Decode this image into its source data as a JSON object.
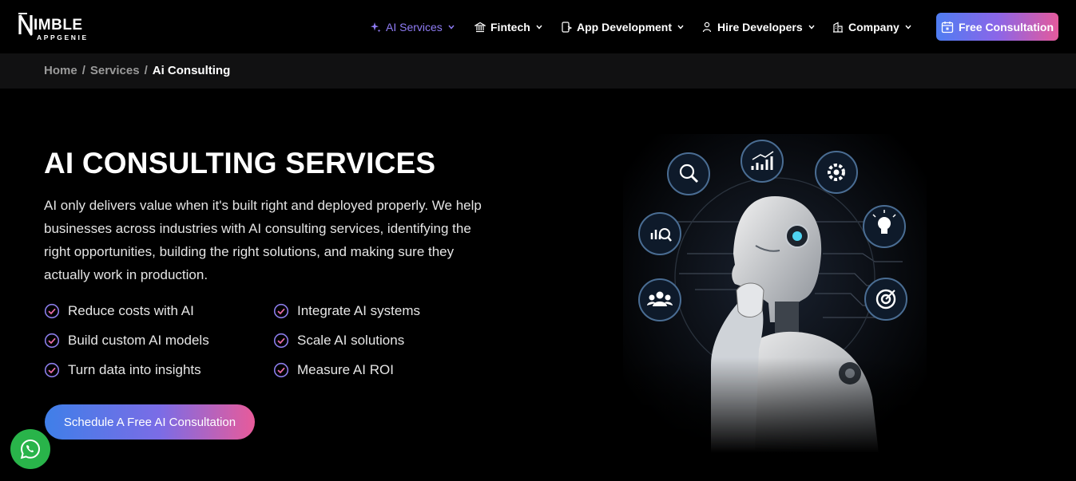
{
  "brand": {
    "name": "NIMBLE",
    "name_rest": "IMBLE",
    "sub": "APPGENIE"
  },
  "nav": {
    "items": [
      {
        "label": "AI Services",
        "icon": "sparkle-icon",
        "active": true
      },
      {
        "label": "Fintech",
        "icon": "bank-icon",
        "active": false
      },
      {
        "label": "App Development",
        "icon": "app-dev-icon",
        "active": false
      },
      {
        "label": "Hire Developers",
        "icon": "developer-icon",
        "active": false
      },
      {
        "label": "Company",
        "icon": "building-icon",
        "active": false
      }
    ],
    "cta": {
      "label": "Free Consultation",
      "icon": "calendar-icon"
    }
  },
  "breadcrumb": {
    "home": "Home",
    "services": "Services",
    "current": "Ai Consulting",
    "separator": "/"
  },
  "hero": {
    "title": "AI CONSULTING SERVICES",
    "description": "AI only delivers value when it's built right and deployed properly. We help businesses across industries with AI consulting services, identifying the right opportunities, building the right solutions, and making sure they actually work in production.",
    "features": [
      "Reduce costs with AI",
      "Integrate AI systems",
      "Build custom AI models",
      "Scale AI solutions",
      "Turn data into insights",
      "Measure AI ROI"
    ],
    "cta_label": "Schedule A Free AI Consultation"
  },
  "colors": {
    "accent_purple": "#8f7cf5",
    "gradient_start": "#4f7df2",
    "gradient_end": "#e45a9c",
    "whatsapp_green": "#29b44a",
    "background": "#000000"
  },
  "icons": {
    "check": "check-circle-icon",
    "whatsapp": "whatsapp-icon",
    "illustration": "ai-robot-illustration",
    "orbit_icons": [
      "search-icon",
      "growth-chart-icon",
      "gear-icon",
      "analytics-search-icon",
      "lightbulb-icon",
      "team-icon",
      "target-icon"
    ]
  }
}
